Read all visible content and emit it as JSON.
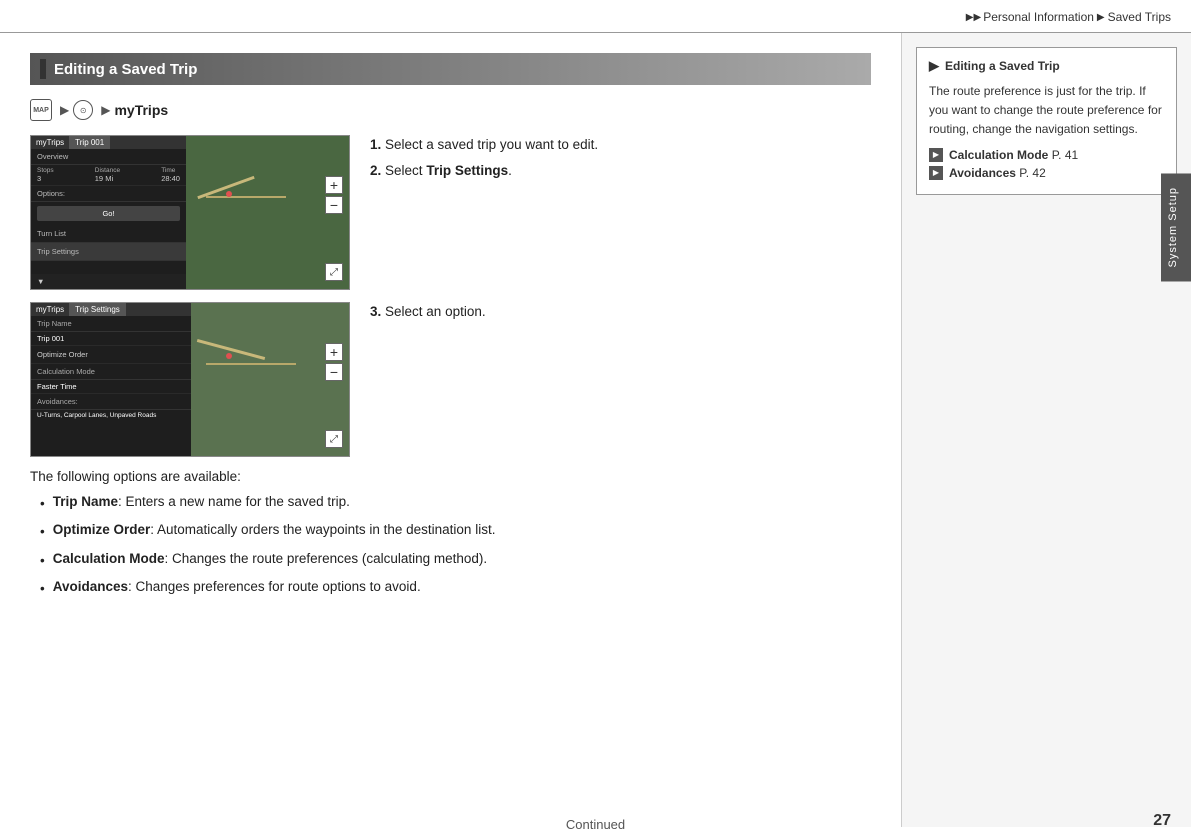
{
  "header": {
    "breadcrumb": {
      "arrows": "▶▶",
      "personal_info": "Personal Information",
      "arrow2": "▶",
      "saved_trips": "Saved Trips"
    }
  },
  "section": {
    "title": "Editing a Saved Trip"
  },
  "nav_path": {
    "icon1_text": "MAP",
    "icon2_text": "⊙",
    "label": "myTrips"
  },
  "steps": {
    "step1_prefix": "1.",
    "step1_text": "Select a saved trip you want to edit.",
    "step2_prefix": "2.",
    "step2_text": "Select ",
    "step2_bold": "Trip Settings",
    "step2_end": ".",
    "step3_prefix": "3.",
    "step3_text": "Select an option."
  },
  "following_text": "The following options are available:",
  "bullets": [
    {
      "term": "Trip Name",
      "desc": ": Enters a new name for the saved trip."
    },
    {
      "term": "Optimize Order",
      "desc": ": Automatically orders the waypoints in the destination list."
    },
    {
      "term": "Calculation Mode",
      "desc": ": Changes the route preferences (calculating method)."
    },
    {
      "term": "Avoidances",
      "desc": ": Changes preferences for route options to avoid."
    }
  ],
  "sidebar": {
    "title_icon": "▶",
    "title": "Editing a Saved Trip",
    "note_text": "The route preference is just for the trip. If you want to change the route preference for routing, change the navigation settings.",
    "link1_icon": "▶",
    "link1_bold": "Calculation Mode",
    "link1_page": "P. 41",
    "link2_icon": "▶",
    "link2_bold": "Avoidances",
    "link2_page": "P. 42"
  },
  "system_setup_label": "System Setup",
  "footer": {
    "continued": "Continued",
    "page_number": "27"
  },
  "screenshot1": {
    "tab1": "myTrips",
    "tab2": "Trip 001",
    "section1": "Overview",
    "stops_label": "Stops",
    "stops_val": "3",
    "dist_label": "Distance",
    "dist_val": "19 Mi",
    "time_label": "Time",
    "time_val": "28:40",
    "section2": "Options:",
    "go_btn": "Go!",
    "turn_list": "Turn List",
    "trip_settings": "Trip Settings"
  },
  "screenshot2": {
    "tab1": "myTrips",
    "tab2": "Trip Settings",
    "trip_name_label": "Trip Name",
    "trip_name_val": "Trip 001",
    "optimize": "Optimize Order",
    "calc_mode_label": "Calculation Mode",
    "calc_mode_val": "Faster Time",
    "avoidances_label": "Avoidances:",
    "avoidances_val": "U-Turns, Carpool Lanes, Unpaved Roads"
  }
}
